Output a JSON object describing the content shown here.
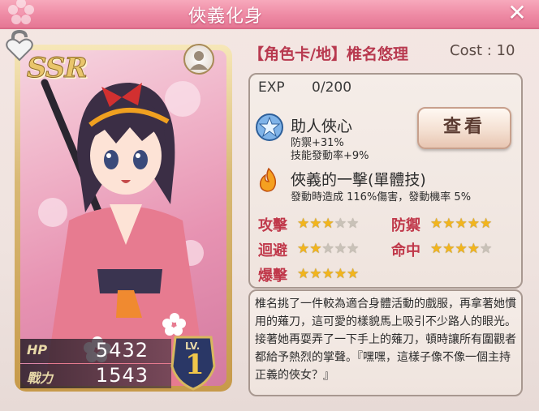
{
  "window": {
    "title": "俠義化身",
    "close_label": "✕"
  },
  "card": {
    "rarity": "SSR",
    "hp_label": "HP",
    "hp_value": "5432",
    "power_label": "戰力",
    "power_value": "1543",
    "level_label": "LV.",
    "level_value": "1"
  },
  "info": {
    "title": "【角色卡/地】椎名悠理",
    "cost": "Cost : 10",
    "exp_label": "EXP",
    "exp_value": "0/200"
  },
  "skill1": {
    "name": "助人俠心",
    "line1": "防禦+31%",
    "line2": "技能發動率+9%",
    "icon": "blue-star-icon"
  },
  "view_button": "查看",
  "skill2": {
    "name": "俠義的一擊(單體技)",
    "line1": "發動時造成 116%傷害，發動機率 5%",
    "icon": "flame-icon"
  },
  "attributes": [
    {
      "label": "攻擊",
      "rating": 3,
      "max": 5
    },
    {
      "label": "防禦",
      "rating": 5,
      "max": 5
    },
    {
      "label": "迴避",
      "rating": 2,
      "max": 5
    },
    {
      "label": "命中",
      "rating": 4,
      "max": 5
    },
    {
      "label": "爆擊",
      "rating": 5,
      "max": 5
    }
  ],
  "description": "椎名挑了一件較為適合身體活動的戲服，再拿著她慣用的薙刀，這可愛的樣貌馬上吸引不少路人的眼光。接著她再耍弄了一下手上的薙刀，頓時讓所有圍觀者都給予熱烈的掌聲。『嘿嘿，這樣子像不像一個主持正義的俠女？』",
  "colors": {
    "accent": "#e57794",
    "attr_label": "#c0384a",
    "star_on": "#f2b51d"
  }
}
